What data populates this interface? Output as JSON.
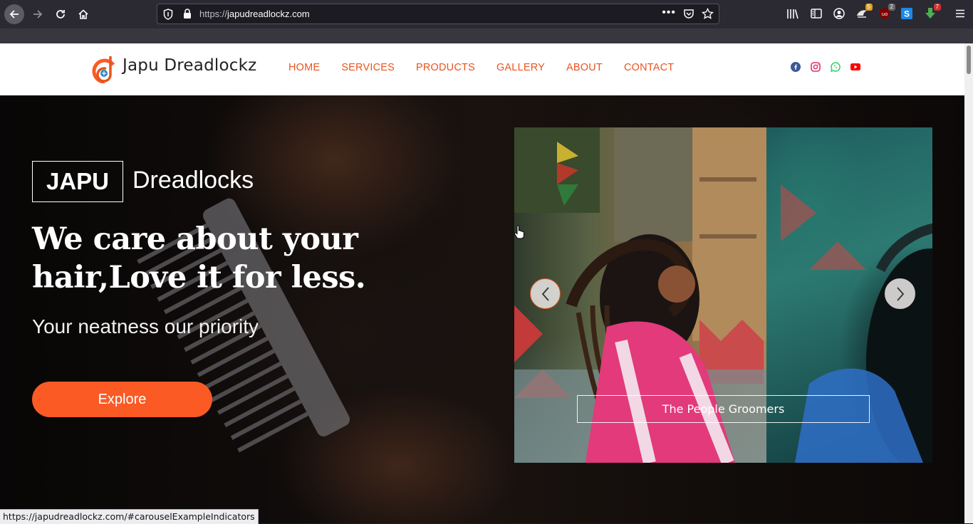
{
  "browser": {
    "url_scheme": "https://",
    "url_host": "japudreadlockz.com",
    "page_actions": "•••",
    "badges": {
      "ext1": "5",
      "ublock": "2",
      "downloads": "7"
    }
  },
  "site": {
    "brand": "Japu Dreadlockz",
    "nav": [
      "HOME",
      "SERVICES",
      "PRODUCTS",
      "GALLERY",
      "ABOUT",
      "CONTACT"
    ],
    "accent_color": "#fb5a24",
    "nav_color": "#e8541e"
  },
  "hero": {
    "badge_word": "JAPU",
    "badge_rest": "Dreadlocks",
    "headline": "We care about your hair,Love it for less.",
    "tagline": "Your neatness our priority",
    "cta": "Explore"
  },
  "carousel": {
    "caption": "The People Groomers"
  },
  "status_bar": "https://japudreadlockz.com/#carouselExampleIndicators"
}
